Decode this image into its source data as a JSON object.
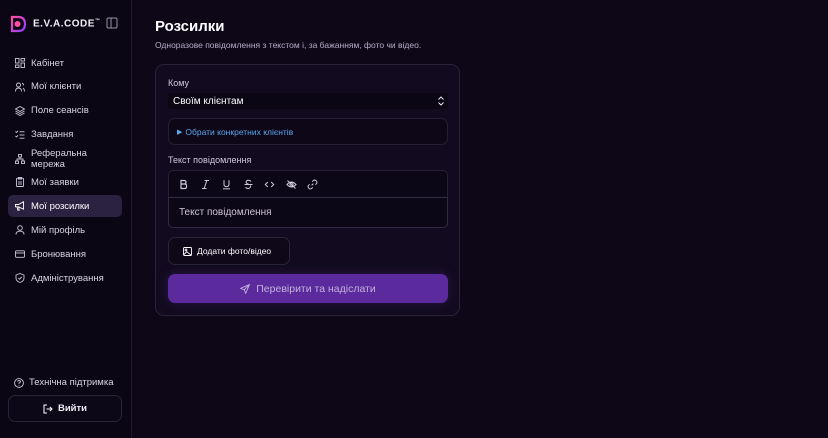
{
  "brand": {
    "name": "E.V.A.CODE",
    "mark": "™"
  },
  "sidebar": {
    "items": [
      {
        "label": "Кабінет",
        "icon": "dashboard-icon",
        "active": false
      },
      {
        "label": "Мої клієнти",
        "icon": "users-icon",
        "active": false
      },
      {
        "label": "Поле сеансів",
        "icon": "layers-icon",
        "active": false
      },
      {
        "label": "Завдання",
        "icon": "list-checks-icon",
        "active": false
      },
      {
        "label": "Реферальна мережа",
        "icon": "network-icon",
        "active": false
      },
      {
        "label": "Мої заявки",
        "icon": "clipboard-icon",
        "active": false
      },
      {
        "label": "Мої розсилки",
        "icon": "megaphone-icon",
        "active": true
      },
      {
        "label": "Мій профіль",
        "icon": "user-icon",
        "active": false
      },
      {
        "label": "Бронювання",
        "icon": "card-icon",
        "active": false
      },
      {
        "label": "Адміністрування",
        "icon": "shield-icon",
        "active": false
      }
    ],
    "support_label": "Технічна підтримка",
    "logout_label": "Вийти"
  },
  "page": {
    "title": "Розсилки",
    "subtitle": "Одноразове повідомлення з текстом і, за бажанням, фото чи відео."
  },
  "form": {
    "recipient_label": "Кому",
    "recipient_value": "Своїм клієнтам",
    "pick_clients_label": "Обрати конкретних клієнтів",
    "message_label": "Текст повідомлення",
    "message_placeholder": "Текст повідомлення",
    "upload_label": "Додати фото/відео",
    "submit_label": "Перевірити та надіслати",
    "toolbar": [
      "bold",
      "italic",
      "underline",
      "strikethrough",
      "code",
      "spoiler",
      "link"
    ]
  },
  "colors": {
    "background": "#0d0718",
    "sidebar": "#0a0613",
    "active_nav": "#2a2240",
    "accent": "#5b2a9c",
    "link": "#5ba7f0"
  }
}
